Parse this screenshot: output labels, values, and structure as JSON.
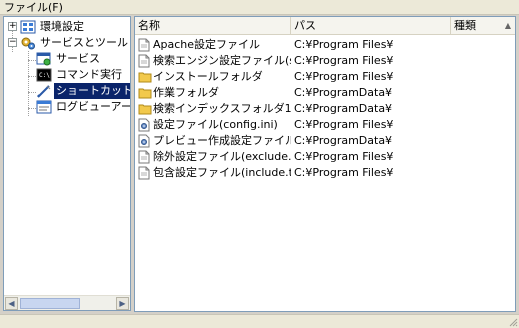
{
  "menu": {
    "file_label": "ファイル(F)"
  },
  "tree": {
    "items": [
      {
        "label": "環境設定",
        "icon": "settings-grid-icon"
      },
      {
        "label": "サービスとツール",
        "icon": "tools-gear-icon"
      },
      {
        "label": "サービス",
        "icon": "service-window-icon"
      },
      {
        "label": "コマンド実行",
        "icon": "console-icon"
      },
      {
        "label": "ショートカット",
        "icon": "shortcut-pen-icon",
        "selected": true
      },
      {
        "label": "ログビューアー",
        "icon": "log-viewer-icon"
      }
    ]
  },
  "list": {
    "columns": [
      "名称",
      "パス",
      "種類"
    ],
    "rows": [
      {
        "name": "Apache設定ファイル",
        "path": "C:¥Program Files¥",
        "type": "",
        "icon": "document-icon"
      },
      {
        "name": "検索エンジン設定ファイル(solr.cor",
        "path": "C:¥Program Files¥",
        "type": "",
        "icon": "document-icon"
      },
      {
        "name": "インストールフォルダ",
        "path": "C:¥Program Files¥",
        "type": "",
        "icon": "folder-icon"
      },
      {
        "name": "作業フォルダ",
        "path": "C:¥ProgramData¥",
        "type": "",
        "icon": "folder-icon"
      },
      {
        "name": "検索インデックスフォルダ1",
        "path": "C:¥ProgramData¥",
        "type": "",
        "icon": "folder-icon"
      },
      {
        "name": "設定ファイル(config.ini)",
        "path": "C:¥Program Files¥",
        "type": "",
        "icon": "config-file-icon"
      },
      {
        "name": "プレビュー作成設定ファイル(crawl.",
        "path": "C:¥ProgramData¥",
        "type": "",
        "icon": "config-file-icon"
      },
      {
        "name": "除外設定ファイル(exclude.txt)",
        "path": "C:¥Program Files¥",
        "type": "",
        "icon": "document-icon"
      },
      {
        "name": "包含設定ファイル(include.txt)",
        "path": "C:¥Program Files¥",
        "type": "",
        "icon": "document-icon"
      }
    ]
  },
  "colors": {
    "selection_bg": "#0a246a",
    "folder": "#f2c94c",
    "window_bg": "#d4d0c8"
  }
}
